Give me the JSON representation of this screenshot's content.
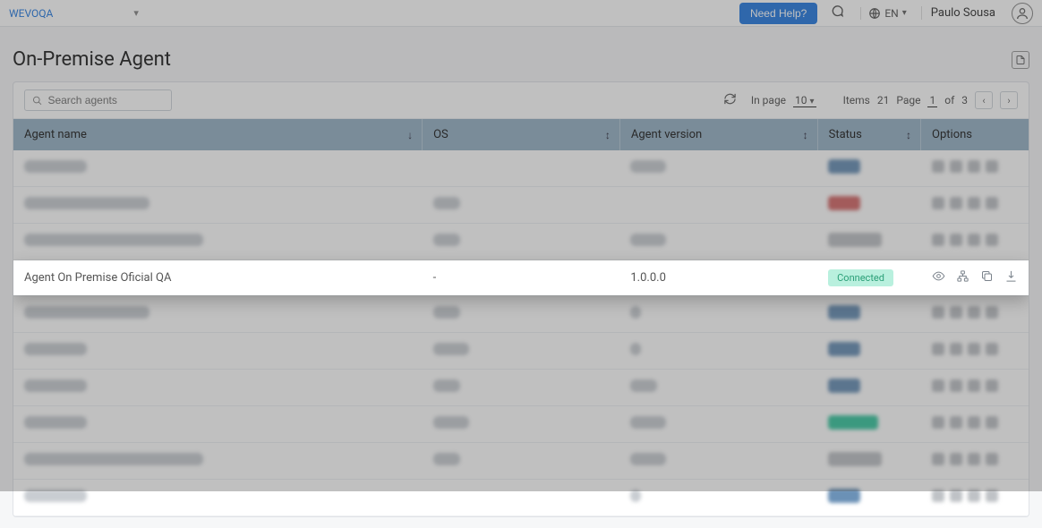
{
  "topbar": {
    "tenant": "WEVOQA",
    "help_label": "Need Help?",
    "lang": "EN",
    "user": "Paulo Sousa"
  },
  "page": {
    "title": "On-Premise Agent"
  },
  "search": {
    "placeholder": "Search agents"
  },
  "pager": {
    "in_page_label": "In page",
    "per_page": "10",
    "items_label": "Items",
    "items_count": "21",
    "page_label": "Page",
    "page_current": "1",
    "of_label": "of",
    "page_total": "3"
  },
  "columns": {
    "name": "Agent name",
    "os": "OS",
    "version": "Agent version",
    "status": "Status",
    "options": "Options"
  },
  "highlight_row": {
    "name": "Agent On Premise Oficial QA",
    "os": "-",
    "version": "1.0.0.0",
    "status": "Connected"
  }
}
